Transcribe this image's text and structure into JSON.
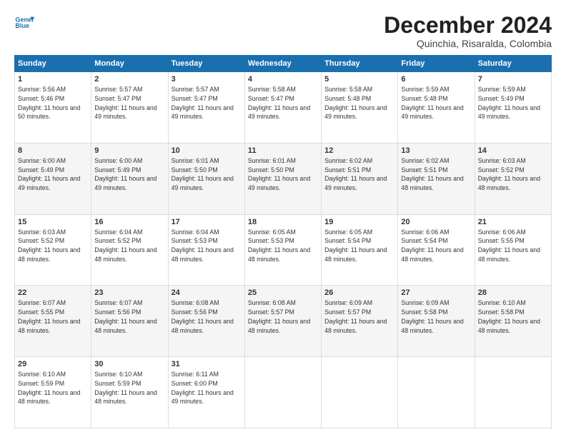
{
  "logo": {
    "line1": "General",
    "line2": "Blue"
  },
  "title": "December 2024",
  "subtitle": "Quinchia, Risaralda, Colombia",
  "headers": [
    "Sunday",
    "Monday",
    "Tuesday",
    "Wednesday",
    "Thursday",
    "Friday",
    "Saturday"
  ],
  "weeks": [
    [
      {
        "day": "1",
        "sunrise": "5:56 AM",
        "sunset": "5:46 PM",
        "daylight": "11 hours and 50 minutes."
      },
      {
        "day": "2",
        "sunrise": "5:57 AM",
        "sunset": "5:47 PM",
        "daylight": "11 hours and 49 minutes."
      },
      {
        "day": "3",
        "sunrise": "5:57 AM",
        "sunset": "5:47 PM",
        "daylight": "11 hours and 49 minutes."
      },
      {
        "day": "4",
        "sunrise": "5:58 AM",
        "sunset": "5:47 PM",
        "daylight": "11 hours and 49 minutes."
      },
      {
        "day": "5",
        "sunrise": "5:58 AM",
        "sunset": "5:48 PM",
        "daylight": "11 hours and 49 minutes."
      },
      {
        "day": "6",
        "sunrise": "5:59 AM",
        "sunset": "5:48 PM",
        "daylight": "11 hours and 49 minutes."
      },
      {
        "day": "7",
        "sunrise": "5:59 AM",
        "sunset": "5:49 PM",
        "daylight": "11 hours and 49 minutes."
      }
    ],
    [
      {
        "day": "8",
        "sunrise": "6:00 AM",
        "sunset": "5:49 PM",
        "daylight": "11 hours and 49 minutes."
      },
      {
        "day": "9",
        "sunrise": "6:00 AM",
        "sunset": "5:49 PM",
        "daylight": "11 hours and 49 minutes."
      },
      {
        "day": "10",
        "sunrise": "6:01 AM",
        "sunset": "5:50 PM",
        "daylight": "11 hours and 49 minutes."
      },
      {
        "day": "11",
        "sunrise": "6:01 AM",
        "sunset": "5:50 PM",
        "daylight": "11 hours and 49 minutes."
      },
      {
        "day": "12",
        "sunrise": "6:02 AM",
        "sunset": "5:51 PM",
        "daylight": "11 hours and 49 minutes."
      },
      {
        "day": "13",
        "sunrise": "6:02 AM",
        "sunset": "5:51 PM",
        "daylight": "11 hours and 48 minutes."
      },
      {
        "day": "14",
        "sunrise": "6:03 AM",
        "sunset": "5:52 PM",
        "daylight": "11 hours and 48 minutes."
      }
    ],
    [
      {
        "day": "15",
        "sunrise": "6:03 AM",
        "sunset": "5:52 PM",
        "daylight": "11 hours and 48 minutes."
      },
      {
        "day": "16",
        "sunrise": "6:04 AM",
        "sunset": "5:52 PM",
        "daylight": "11 hours and 48 minutes."
      },
      {
        "day": "17",
        "sunrise": "6:04 AM",
        "sunset": "5:53 PM",
        "daylight": "11 hours and 48 minutes."
      },
      {
        "day": "18",
        "sunrise": "6:05 AM",
        "sunset": "5:53 PM",
        "daylight": "11 hours and 48 minutes."
      },
      {
        "day": "19",
        "sunrise": "6:05 AM",
        "sunset": "5:54 PM",
        "daylight": "11 hours and 48 minutes."
      },
      {
        "day": "20",
        "sunrise": "6:06 AM",
        "sunset": "5:54 PM",
        "daylight": "11 hours and 48 minutes."
      },
      {
        "day": "21",
        "sunrise": "6:06 AM",
        "sunset": "5:55 PM",
        "daylight": "11 hours and 48 minutes."
      }
    ],
    [
      {
        "day": "22",
        "sunrise": "6:07 AM",
        "sunset": "5:55 PM",
        "daylight": "11 hours and 48 minutes."
      },
      {
        "day": "23",
        "sunrise": "6:07 AM",
        "sunset": "5:56 PM",
        "daylight": "11 hours and 48 minutes."
      },
      {
        "day": "24",
        "sunrise": "6:08 AM",
        "sunset": "5:56 PM",
        "daylight": "11 hours and 48 minutes."
      },
      {
        "day": "25",
        "sunrise": "6:08 AM",
        "sunset": "5:57 PM",
        "daylight": "11 hours and 48 minutes."
      },
      {
        "day": "26",
        "sunrise": "6:09 AM",
        "sunset": "5:57 PM",
        "daylight": "11 hours and 48 minutes."
      },
      {
        "day": "27",
        "sunrise": "6:09 AM",
        "sunset": "5:58 PM",
        "daylight": "11 hours and 48 minutes."
      },
      {
        "day": "28",
        "sunrise": "6:10 AM",
        "sunset": "5:58 PM",
        "daylight": "11 hours and 48 minutes."
      }
    ],
    [
      {
        "day": "29",
        "sunrise": "6:10 AM",
        "sunset": "5:59 PM",
        "daylight": "11 hours and 48 minutes."
      },
      {
        "day": "30",
        "sunrise": "6:10 AM",
        "sunset": "5:59 PM",
        "daylight": "11 hours and 48 minutes."
      },
      {
        "day": "31",
        "sunrise": "6:11 AM",
        "sunset": "6:00 PM",
        "daylight": "11 hours and 49 minutes."
      },
      null,
      null,
      null,
      null
    ]
  ]
}
